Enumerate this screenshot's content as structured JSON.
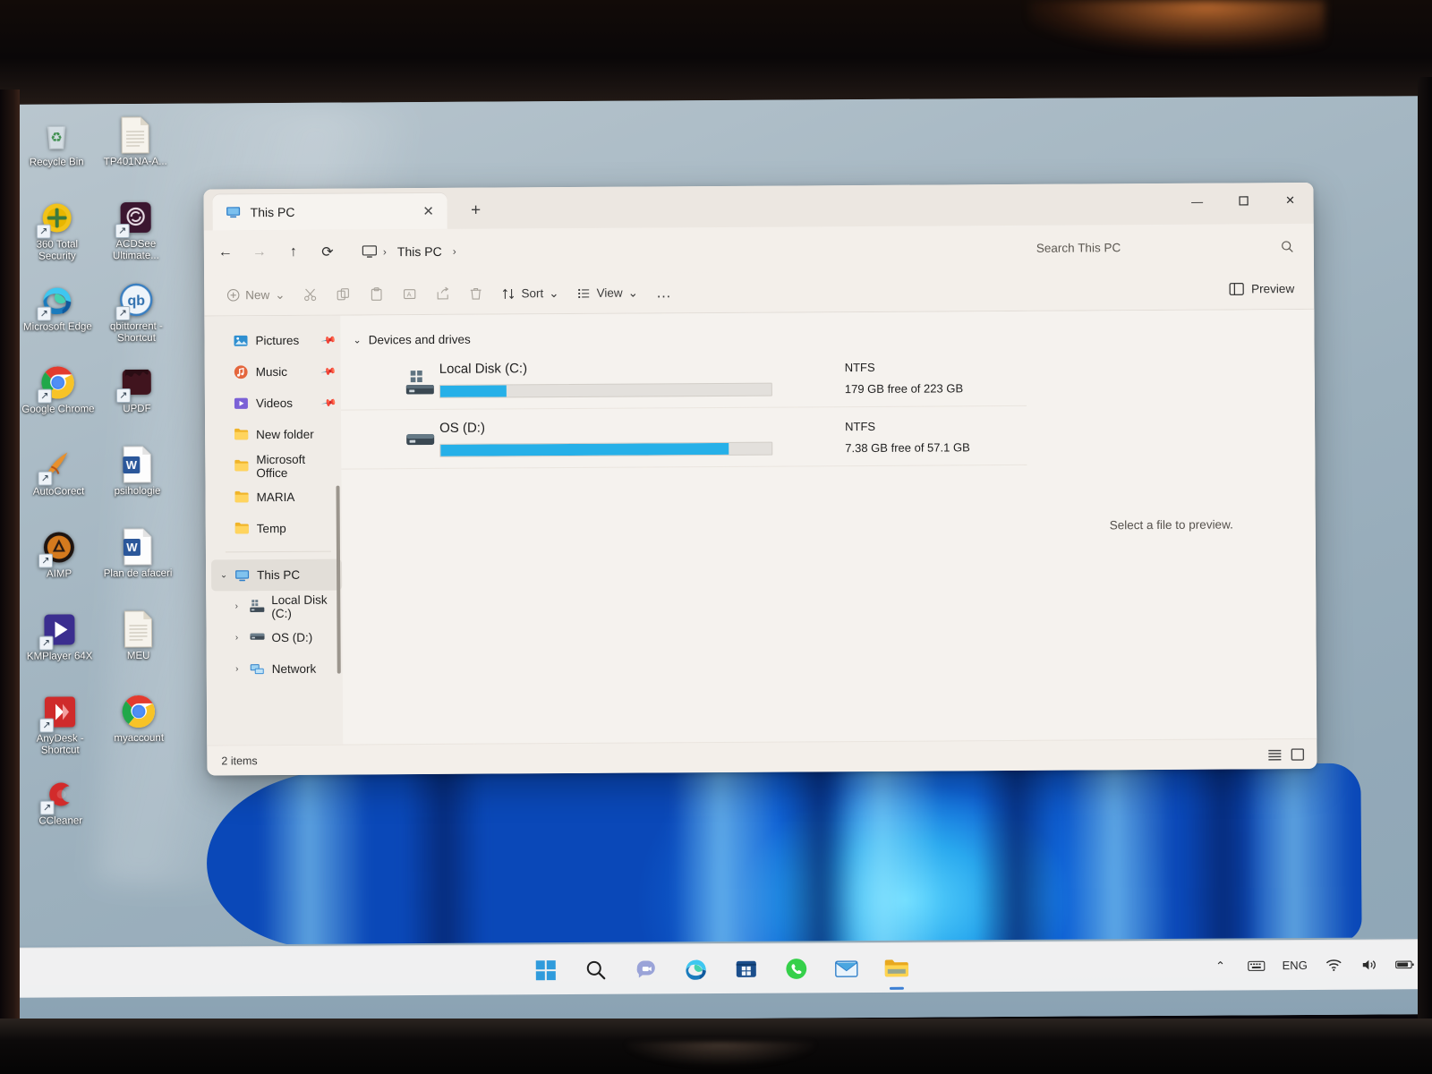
{
  "desktop": {
    "icons": [
      {
        "label": "Recycle Bin",
        "icon": "recycle-bin-icon",
        "color": "#c6cdd2",
        "glyph": "♻",
        "shortcut": false
      },
      {
        "label": "TP401NA-A...",
        "icon": "text-document-icon",
        "color": "#f2efe6",
        "glyph": "",
        "shortcut": false
      },
      {
        "label": "360 Total Security",
        "icon": "360-total-security-icon",
        "color": "#e8b600",
        "glyph": "✛",
        "shortcut": true
      },
      {
        "label": "ACDSee Ultimate...",
        "icon": "acdsee-ultimate-icon",
        "color": "#3b1630",
        "glyph": "❖",
        "shortcut": true
      },
      {
        "label": "Microsoft Edge",
        "icon": "microsoft-edge-icon",
        "color": "#1b7fc4",
        "glyph": "",
        "shortcut": true
      },
      {
        "label": "qbittorrent - Shortcut",
        "icon": "qbittorrent-icon",
        "color": "#2f7fc1",
        "glyph": "qb",
        "shortcut": true
      },
      {
        "label": "Google Chrome",
        "icon": "google-chrome-icon",
        "color": "#ffffff",
        "glyph": "",
        "shortcut": true
      },
      {
        "label": "UPDF",
        "icon": "updf-icon",
        "color": "#3b1a22",
        "glyph": "▰",
        "shortcut": true
      },
      {
        "label": "AutoCorect",
        "icon": "autocorect-icon",
        "color": "#d98a2b",
        "glyph": "✎",
        "shortcut": true
      },
      {
        "label": "psihologie",
        "icon": "word-document-icon",
        "color": "#2b579a",
        "glyph": "W",
        "shortcut": false
      },
      {
        "label": "AIMP",
        "icon": "aimp-icon",
        "color": "#2a1a12",
        "glyph": "A",
        "shortcut": true
      },
      {
        "label": "Plan de afaceri",
        "icon": "word-document-icon",
        "color": "#2b579a",
        "glyph": "W",
        "shortcut": false
      },
      {
        "label": "KMPlayer 64X",
        "icon": "kmplayer-icon",
        "color": "#3b2e8f",
        "glyph": "▶",
        "shortcut": true
      },
      {
        "label": "MEU",
        "icon": "text-document-icon",
        "color": "#f2efe6",
        "glyph": "",
        "shortcut": false
      },
      {
        "label": "AnyDesk - Shortcut",
        "icon": "anydesk-icon",
        "color": "#d02c2c",
        "glyph": "»",
        "shortcut": true
      },
      {
        "label": "myaccount",
        "icon": "google-chrome-icon",
        "color": "#ffffff",
        "glyph": "",
        "shortcut": false
      },
      {
        "label": "CCleaner",
        "icon": "ccleaner-icon",
        "color": "#d22b2b",
        "glyph": "C",
        "shortcut": true
      }
    ]
  },
  "window": {
    "tab": {
      "label": "This PC",
      "icon": "this-pc-icon",
      "close": "✕"
    },
    "new_tab": "+",
    "controls": {
      "minimize": "—",
      "maximize": "▢",
      "close": "✕"
    },
    "nav": {
      "back": "←",
      "forward": "→",
      "up": "↑",
      "refresh": "⟳"
    },
    "breadcrumb": {
      "root_icon": "this-pc-icon",
      "items": [
        "This PC"
      ],
      "separator": "›"
    },
    "search": {
      "placeholder": "Search This PC",
      "icon": "search-icon"
    },
    "command_bar": {
      "new_label": "New",
      "new_chevron": "⌄",
      "cut": "cut-icon",
      "copy": "copy-icon",
      "paste": "paste-icon",
      "rename": "rename-icon",
      "share": "share-icon",
      "delete": "delete-icon",
      "sort_label": "Sort",
      "sort_chevron": "⌄",
      "view_label": "View",
      "view_chevron": "⌄",
      "more": "…",
      "preview_label": "Preview",
      "preview_icon": "preview-pane-icon"
    }
  },
  "sidebar": {
    "items": [
      {
        "label": "Pictures",
        "icon": "pictures-folder-icon",
        "pinned": true,
        "indent": 0,
        "expander": "",
        "selected": false
      },
      {
        "label": "Music",
        "icon": "music-folder-icon",
        "pinned": true,
        "indent": 0,
        "expander": "",
        "selected": false
      },
      {
        "label": "Videos",
        "icon": "videos-folder-icon",
        "pinned": true,
        "indent": 0,
        "expander": "",
        "selected": false
      },
      {
        "label": "New folder",
        "icon": "folder-icon",
        "pinned": false,
        "indent": 0,
        "expander": "",
        "selected": false
      },
      {
        "label": "Microsoft Office",
        "icon": "folder-icon",
        "pinned": false,
        "indent": 0,
        "expander": "",
        "selected": false
      },
      {
        "label": "MARIA",
        "icon": "folder-icon",
        "pinned": false,
        "indent": 0,
        "expander": "",
        "selected": false
      },
      {
        "label": "Temp",
        "icon": "folder-icon",
        "pinned": false,
        "indent": 0,
        "expander": "",
        "selected": false
      }
    ],
    "tree": [
      {
        "label": "This PC",
        "icon": "this-pc-icon",
        "expander": "⌄",
        "selected": true,
        "indent": 0
      },
      {
        "label": "Local Disk (C:)",
        "icon": "local-disk-icon",
        "expander": "›",
        "selected": false,
        "indent": 1
      },
      {
        "label": "OS (D:)",
        "icon": "hard-drive-icon",
        "expander": "›",
        "selected": false,
        "indent": 1
      },
      {
        "label": "Network",
        "icon": "network-icon",
        "expander": "›",
        "selected": false,
        "indent": 1
      }
    ]
  },
  "main": {
    "group_header": {
      "label": "Devices and drives",
      "chevron": "⌄"
    },
    "drives": [
      {
        "name": "Local Disk (C:)",
        "icon": "local-disk-icon",
        "filesystem": "NTFS",
        "free_text": "179 GB free of 223 GB",
        "free_gb": 179,
        "total_gb": 223,
        "used_percent": 20,
        "bar_color": "#26b0e8"
      },
      {
        "name": "OS (D:)",
        "icon": "hard-drive-icon",
        "filesystem": "NTFS",
        "free_text": "7.38 GB free of 57.1 GB",
        "free_gb": 7.38,
        "total_gb": 57.1,
        "used_percent": 87,
        "bar_color": "#26b0e8"
      }
    ],
    "preview_placeholder": "Select a file to preview."
  },
  "status": {
    "item_count": "2 items",
    "view_list_icon": "list-view-icon",
    "view_details_icon": "details-view-icon"
  },
  "taskbar": {
    "items": [
      {
        "name": "start-button",
        "icon": "windows-logo-icon",
        "active": false
      },
      {
        "name": "search-taskbar-button",
        "icon": "search-icon",
        "active": false
      },
      {
        "name": "chat-button",
        "icon": "chat-icon",
        "active": false
      },
      {
        "name": "edge-button",
        "icon": "microsoft-edge-icon",
        "active": false
      },
      {
        "name": "microsoft-store-button",
        "icon": "microsoft-store-icon",
        "active": false
      },
      {
        "name": "whatsapp-button",
        "icon": "whatsapp-icon",
        "active": false
      },
      {
        "name": "mail-button",
        "icon": "mail-icon",
        "active": false
      },
      {
        "name": "file-explorer-button",
        "icon": "file-explorer-icon",
        "active": true
      }
    ],
    "tray": {
      "overflow": "⌃",
      "keyboard_icon": "keyboard-icon",
      "language": "ENG",
      "wifi_icon": "wifi-icon",
      "volume_icon": "volume-icon",
      "battery_icon": "battery-icon"
    }
  }
}
